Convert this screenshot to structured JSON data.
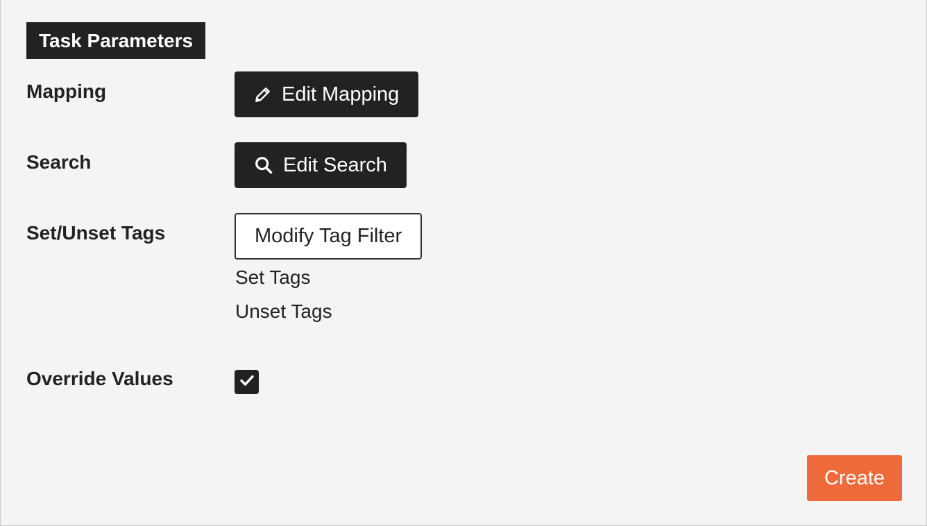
{
  "section": {
    "title": "Task Parameters"
  },
  "mapping": {
    "label": "Mapping",
    "button_label": "Edit Mapping",
    "icon": "pencil-icon"
  },
  "search": {
    "label": "Search",
    "button_label": "Edit Search",
    "icon": "search-icon"
  },
  "tags": {
    "label": "Set/Unset Tags",
    "button_label": "Modify Tag Filter",
    "set_tags_label": "Set Tags",
    "unset_tags_label": "Unset Tags"
  },
  "override": {
    "label": "Override Values",
    "checked": true,
    "icon": "checkmark-icon"
  },
  "footer": {
    "create_label": "Create"
  },
  "colors": {
    "dark": "#222222",
    "accent": "#ee6a3a",
    "background": "#f4f4f4"
  }
}
